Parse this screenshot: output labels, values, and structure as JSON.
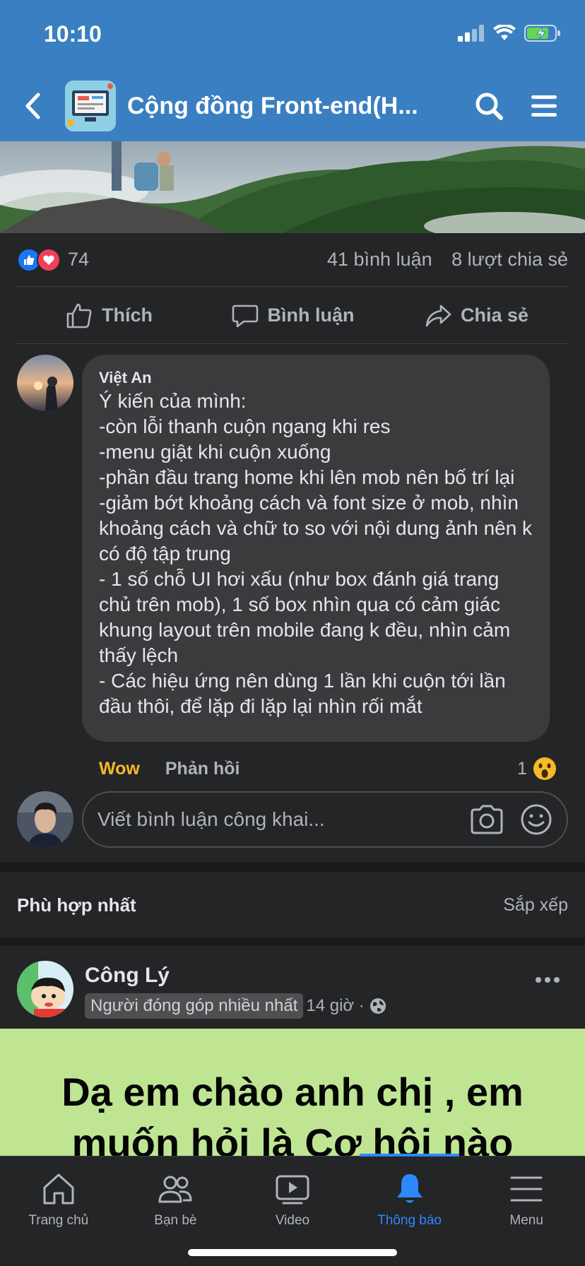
{
  "status_bar": {
    "time": "10:10"
  },
  "header": {
    "title": "Cộng đồng Front-end(H..."
  },
  "reactions": {
    "count": "74",
    "comments": "41 bình luận",
    "shares": "8 lượt chia sẻ"
  },
  "actions": {
    "like": "Thích",
    "comment": "Bình luận",
    "share": "Chia sẻ"
  },
  "comment": {
    "author": "Việt An",
    "text": "Ý kiến của mình:\n-còn lỗi thanh cuộn ngang khi res\n-menu giật khi cuộn xuống\n-phần đầu trang home khi lên mob nên bố trí lại\n-giảm bớt khoảng cách và font size ở mob, nhìn khoảng cách và chữ to so với nội dung ảnh nên k có độ tập trung\n- 1 số chỗ UI hơi xấu (như box đánh giá trang chủ trên mob), 1 số box nhìn qua có cảm giác khung layout trên mobile đang k đều, nhìn cảm thấy lệch\n- Các hiệu ứng nên dùng 1 lần khi cuộn tới lần đầu thôi, để lặp đi lặp lại nhìn rối mắt",
    "reaction_label": "Wow",
    "reply_label": "Phản hồi",
    "reaction_count": "1"
  },
  "write_comment": {
    "placeholder": "Viết bình luận công khai..."
  },
  "sort": {
    "title": "Phù hợp nhất",
    "button": "Sắp xếp"
  },
  "post2": {
    "author": "Công Lý",
    "badge": "Người đóng góp nhiều nhất",
    "time": "14 giờ ·",
    "text": "Dạ em chào anh chị , em muốn hỏi là Cơ hội nào"
  },
  "bottom_nav": [
    {
      "label": "Trang chủ",
      "icon": "home-icon"
    },
    {
      "label": "Bạn bè",
      "icon": "friends-icon"
    },
    {
      "label": "Video",
      "icon": "video-icon"
    },
    {
      "label": "Thông báo",
      "icon": "bell-icon",
      "active": true
    },
    {
      "label": "Menu",
      "icon": "menu-icon"
    }
  ],
  "colors": {
    "header_bg": "#3a7fc1",
    "body_bg": "#242526",
    "accent": "#2d88ff",
    "wow": "#f7b928",
    "post_bg": "#bfe593"
  }
}
